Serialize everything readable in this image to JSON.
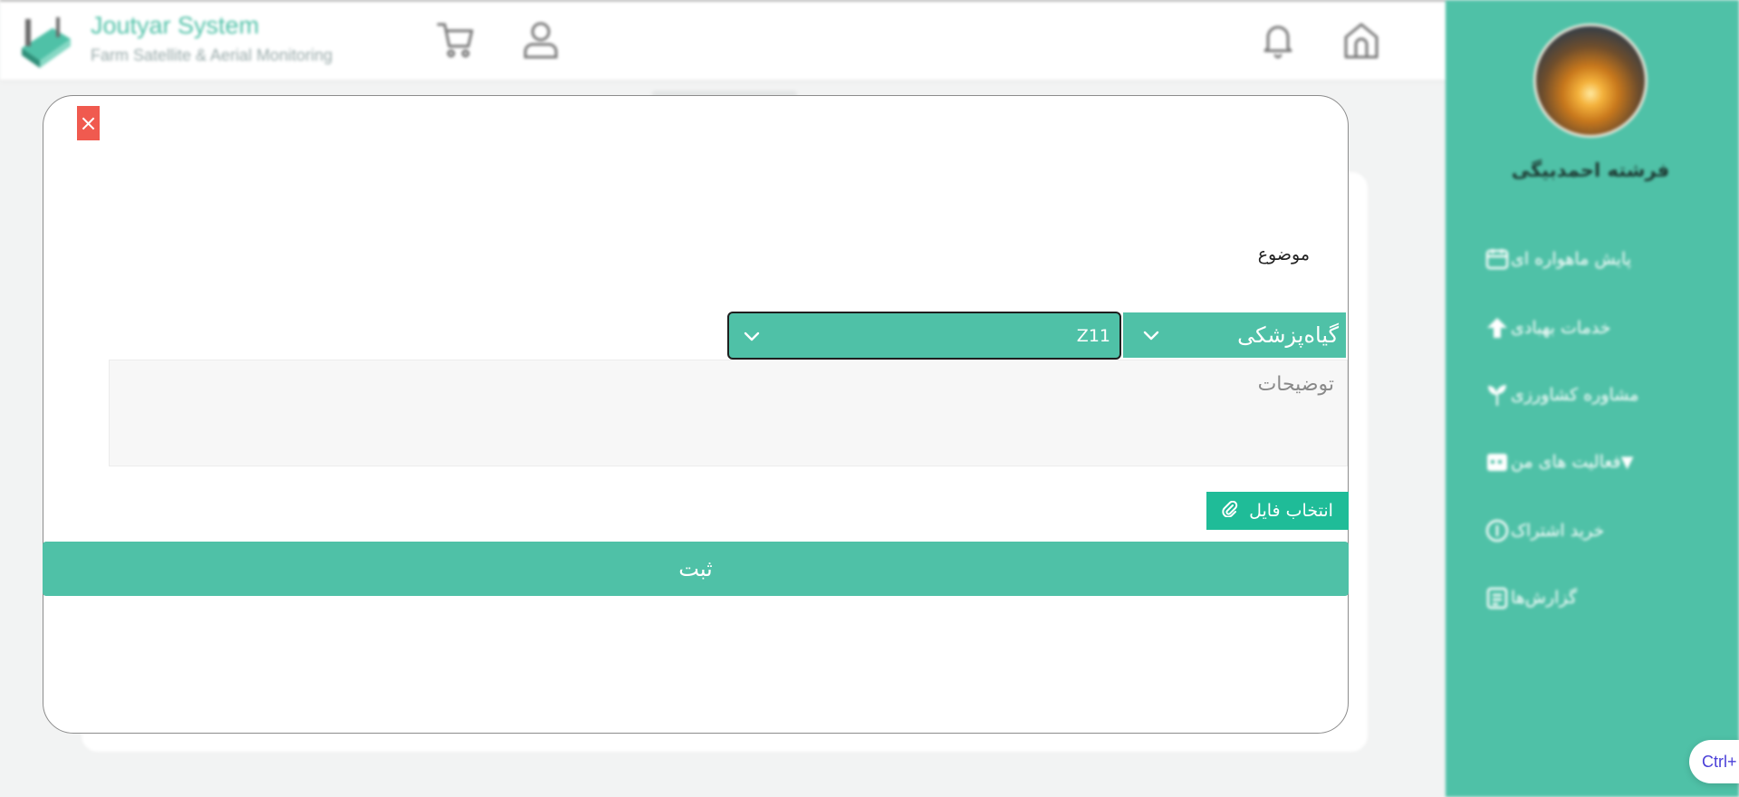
{
  "header": {
    "brand_title": "Joutyar System",
    "brand_subtitle": "Farm Satellite & Aerial Monitoring",
    "icons": [
      "cart-icon",
      "user-icon",
      "bell-icon",
      "home-icon"
    ]
  },
  "sidebar": {
    "username": "فرشته احمدبیگی",
    "items": [
      {
        "label": "پایش ماهواره ای",
        "icon": "satellite-calendar-icon"
      },
      {
        "label": "خدمات بهبادی",
        "icon": "upload-icon"
      },
      {
        "label": "مشاوره کشاورزی",
        "icon": "plant-icon"
      },
      {
        "label": "فعالیت های من",
        "icon": "calendar-icon",
        "caret": "▼"
      },
      {
        "label": "خرید اشتراک",
        "icon": "coin-icon"
      },
      {
        "label": "گزارش‌ها",
        "icon": "report-icon"
      }
    ]
  },
  "modal": {
    "close_symbol": "×",
    "subject_label": "موضوع",
    "category_select": "گیاه‌پزشکی",
    "code_select": "Z11",
    "description_placeholder": "توضیحات",
    "file_button": "انتخاب فایل",
    "submit_button": "ثبت"
  },
  "shortcut_hint": "Ctrl+",
  "colors": {
    "accent": "#4fc1a7",
    "file_button": "#1fbc98",
    "close": "#f05a4f"
  }
}
